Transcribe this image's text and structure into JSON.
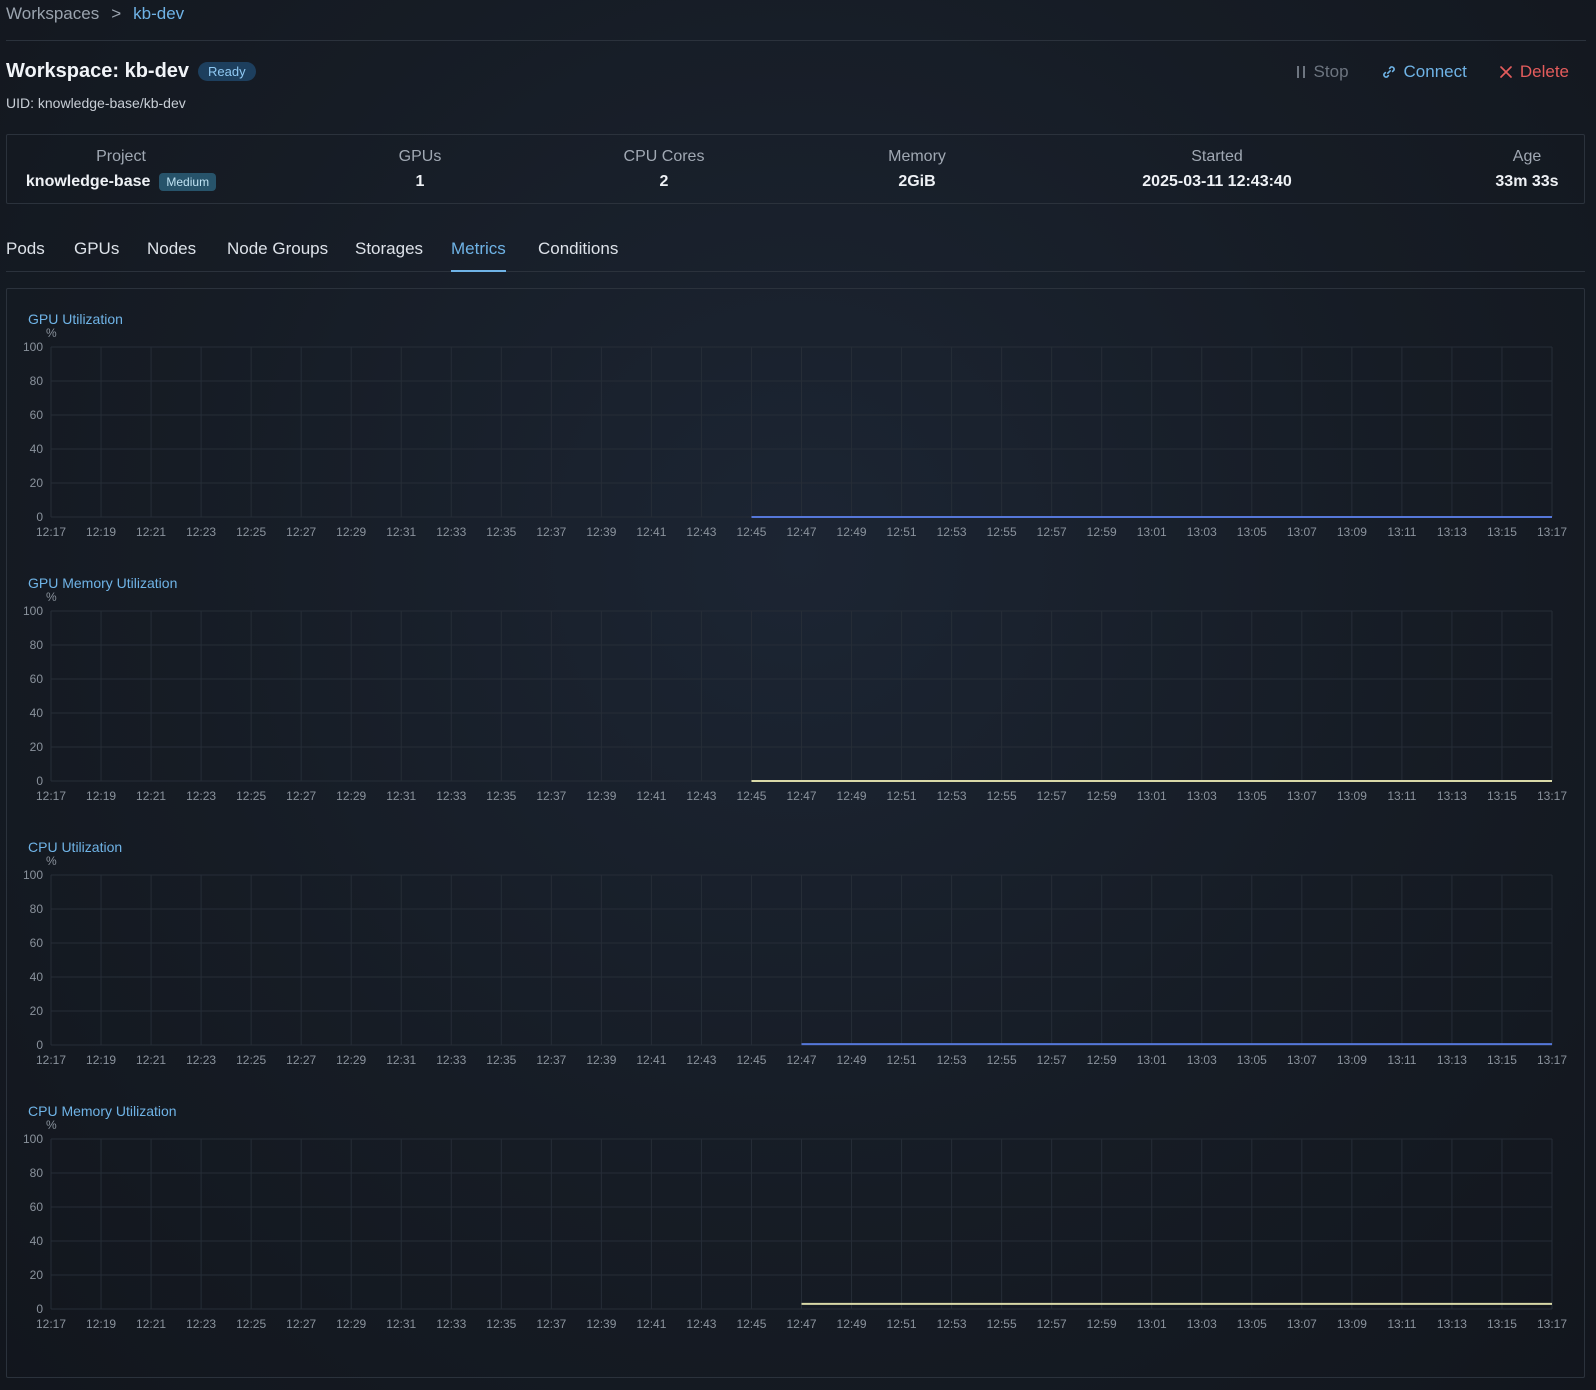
{
  "breadcrumb": {
    "root": "Workspaces",
    "separator": ">",
    "current": "kb-dev"
  },
  "workspace": {
    "title": "Workspace: kb-dev",
    "status": "Ready",
    "uid": "UID: knowledge-base/kb-dev"
  },
  "actions": {
    "stop": "Stop",
    "connect": "Connect",
    "delete": "Delete"
  },
  "summary": {
    "project": {
      "label": "Project",
      "value": "knowledge-base",
      "tier": "Medium"
    },
    "gpus": {
      "label": "GPUs",
      "value": "1"
    },
    "cpu_cores": {
      "label": "CPU Cores",
      "value": "2"
    },
    "memory": {
      "label": "Memory",
      "value": "2GiB"
    },
    "started": {
      "label": "Started",
      "value": "2025-03-11 12:43:40"
    },
    "age": {
      "label": "Age",
      "value": "33m 33s"
    }
  },
  "tabs": [
    {
      "label": "Pods",
      "active": false
    },
    {
      "label": "GPUs",
      "active": false
    },
    {
      "label": "Nodes",
      "active": false
    },
    {
      "label": "Node Groups",
      "active": false
    },
    {
      "label": "Storages",
      "active": false
    },
    {
      "label": "Metrics",
      "active": true
    },
    {
      "label": "Conditions",
      "active": false
    }
  ],
  "colors": {
    "accent": "#6fb3e6",
    "danger": "#e45c5c",
    "series_blue": "#5577d9",
    "series_yellow": "#d9d9a8",
    "grid": "#262d37"
  },
  "chart_data": [
    {
      "type": "line",
      "title": "GPU Utilization",
      "ylabel": "%",
      "ylim": [
        0,
        100
      ],
      "yticks": [
        0,
        20,
        40,
        60,
        80,
        100
      ],
      "x": [
        "12:17",
        "12:19",
        "12:21",
        "12:23",
        "12:25",
        "12:27",
        "12:29",
        "12:31",
        "12:33",
        "12:35",
        "12:37",
        "12:39",
        "12:41",
        "12:43",
        "12:45",
        "12:47",
        "12:49",
        "12:51",
        "12:53",
        "12:55",
        "12:57",
        "12:59",
        "13:01",
        "13:03",
        "13:05",
        "13:07",
        "13:09",
        "13:11",
        "13:13",
        "13:15",
        "13:17"
      ],
      "grid": true,
      "series": [
        {
          "color": "#5577d9",
          "x": [
            "12:45",
            "13:17"
          ],
          "values": [
            0,
            0
          ]
        }
      ]
    },
    {
      "type": "line",
      "title": "GPU Memory Utilization",
      "ylabel": "%",
      "ylim": [
        0,
        100
      ],
      "yticks": [
        0,
        20,
        40,
        60,
        80,
        100
      ],
      "x": [
        "12:17",
        "12:19",
        "12:21",
        "12:23",
        "12:25",
        "12:27",
        "12:29",
        "12:31",
        "12:33",
        "12:35",
        "12:37",
        "12:39",
        "12:41",
        "12:43",
        "12:45",
        "12:47",
        "12:49",
        "12:51",
        "12:53",
        "12:55",
        "12:57",
        "12:59",
        "13:01",
        "13:03",
        "13:05",
        "13:07",
        "13:09",
        "13:11",
        "13:13",
        "13:15",
        "13:17"
      ],
      "grid": true,
      "series": [
        {
          "color": "#d9d9a8",
          "x": [
            "12:45",
            "13:17"
          ],
          "values": [
            0,
            0
          ]
        }
      ]
    },
    {
      "type": "line",
      "title": "CPU Utilization",
      "ylabel": "%",
      "ylim": [
        0,
        100
      ],
      "yticks": [
        0,
        20,
        40,
        60,
        80,
        100
      ],
      "x": [
        "12:17",
        "12:19",
        "12:21",
        "12:23",
        "12:25",
        "12:27",
        "12:29",
        "12:31",
        "12:33",
        "12:35",
        "12:37",
        "12:39",
        "12:41",
        "12:43",
        "12:45",
        "12:47",
        "12:49",
        "12:51",
        "12:53",
        "12:55",
        "12:57",
        "12:59",
        "13:01",
        "13:03",
        "13:05",
        "13:07",
        "13:09",
        "13:11",
        "13:13",
        "13:15",
        "13:17"
      ],
      "grid": true,
      "series": [
        {
          "color": "#5577d9",
          "x": [
            "12:47",
            "13:17"
          ],
          "values": [
            0.5,
            0.5
          ]
        }
      ]
    },
    {
      "type": "line",
      "title": "CPU Memory Utilization",
      "ylabel": "%",
      "ylim": [
        0,
        100
      ],
      "yticks": [
        0,
        20,
        40,
        60,
        80,
        100
      ],
      "x": [
        "12:17",
        "12:19",
        "12:21",
        "12:23",
        "12:25",
        "12:27",
        "12:29",
        "12:31",
        "12:33",
        "12:35",
        "12:37",
        "12:39",
        "12:41",
        "12:43",
        "12:45",
        "12:47",
        "12:49",
        "12:51",
        "12:53",
        "12:55",
        "12:57",
        "12:59",
        "13:01",
        "13:03",
        "13:05",
        "13:07",
        "13:09",
        "13:11",
        "13:13",
        "13:15",
        "13:17"
      ],
      "grid": true,
      "series": [
        {
          "color": "#d9d9a8",
          "x": [
            "12:47",
            "13:17"
          ],
          "values": [
            3,
            3
          ]
        }
      ]
    }
  ]
}
